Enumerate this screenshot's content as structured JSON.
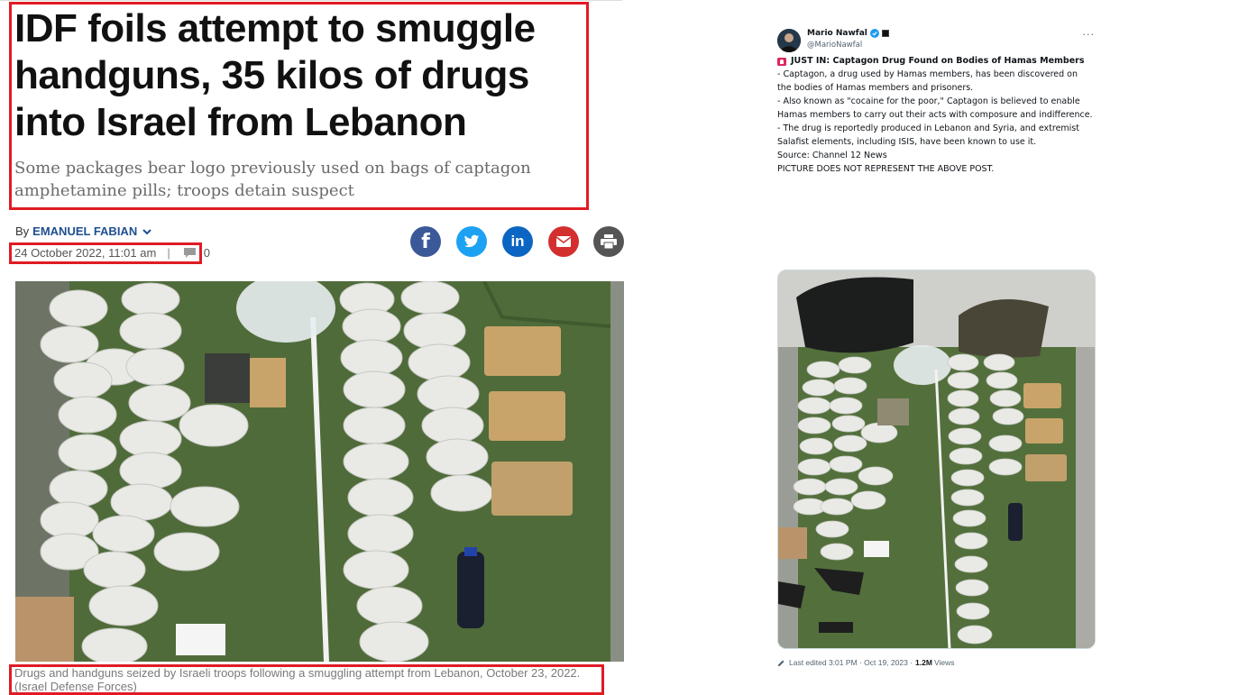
{
  "article": {
    "headline": "IDF foils attempt to smuggle handguns, 35 kilos of drugs into Israel from Lebanon",
    "subhead": "Some packages bear logo previously used on bags of captagon amphetamine pills; troops detain suspect",
    "byline_prefix": "By",
    "author": "EMANUEL FABIAN",
    "date": "24 October 2022, 11:01 am",
    "separator": "|",
    "comment_count": "0",
    "share_icons": [
      "facebook-icon",
      "twitter-icon",
      "linkedin-icon",
      "mail-icon",
      "print-icon"
    ],
    "caption": "Drugs and handguns seized by Israeli troops following a smuggling attempt from Lebanon, October 23, 2022. (Israel Defense Forces)"
  },
  "tweet": {
    "name": "Mario Nawfal",
    "handle": "@MarioNawfal",
    "more": "···",
    "lead": "JUST IN: Captagon Drug Found on Bodies of Hamas Members",
    "paragraphs": [
      "- Captagon, a drug used by Hamas members, has been discovered on the bodies of Hamas members and prisoners.",
      "- Also known as \"cocaine for the poor,\" Captagon is believed to enable Hamas members to carry out their acts with composure and indifference.",
      "- The drug is reportedly produced in Lebanon and Syria, and extremist Salafist elements, including ISIS, have been known to use it.",
      "Source: Channel 12 News",
      "PICTURE DOES NOT REPRESENT THE ABOVE POST."
    ],
    "edited": "Last edited 3:01 PM · Oct 19, 2023 ·",
    "views_count": "1.2M",
    "views_label": "Views"
  },
  "colors": {
    "highlight": "#e01b24",
    "author_link": "#1e4f91",
    "tarp": "#4f6b3a",
    "package": "#e9eae6"
  }
}
